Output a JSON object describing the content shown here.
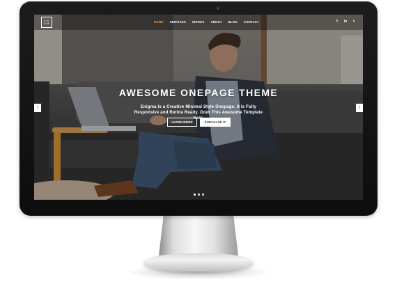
{
  "navbar": {
    "logo": {
      "line1": "EN",
      "line2": "GM"
    },
    "items": [
      {
        "label": "HOME",
        "active": true
      },
      {
        "label": "SERVICES",
        "active": false
      },
      {
        "label": "WORKS",
        "active": false
      },
      {
        "label": "ABOUT",
        "active": false
      },
      {
        "label": "BLOG",
        "active": false
      },
      {
        "label": "CONTACT",
        "active": false
      }
    ],
    "social": [
      {
        "icon": "facebook-icon",
        "glyph": "f"
      },
      {
        "icon": "linkedin-icon",
        "glyph": "in"
      },
      {
        "icon": "twitter-icon",
        "glyph": "t"
      }
    ]
  },
  "hero": {
    "title": "AWESOME ONEPAGE THEME",
    "subtitle": "Enigma Is a Creative Minimal Style Onepage. It Is Fully Responsive and Retina Ready. Grab This Awesome Template Now.",
    "learn_label": "LEARN MORE",
    "purchase_label": "PURCHASE IT"
  },
  "slider": {
    "prev_glyph": "‹",
    "next_glyph": "›",
    "dots": 3,
    "active_dot": 1
  },
  "colors": {
    "accent": "#f2a23a",
    "bezel": "#111111"
  }
}
